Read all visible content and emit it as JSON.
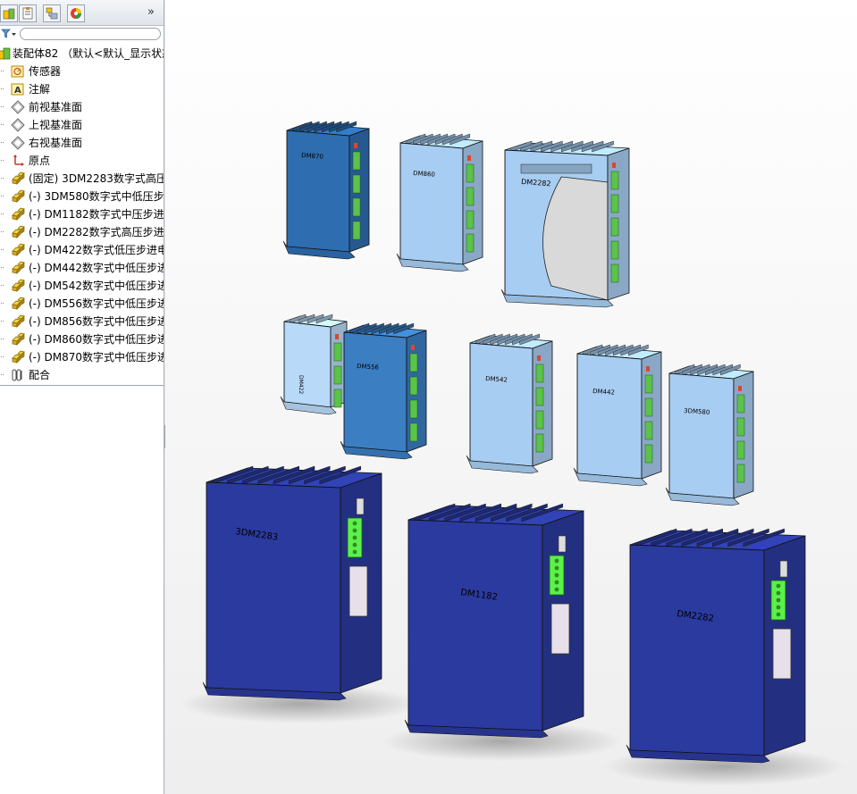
{
  "feature_manager": {
    "tabs": [
      {
        "name": "featuremanager-tree-tab",
        "icon": "assembly-tree-icon"
      },
      {
        "name": "propertymanager-tab",
        "icon": "property-sheet-icon"
      },
      {
        "name": "configurationmanager-tab",
        "icon": "configuration-icon"
      },
      {
        "name": "displaymanager-tab",
        "icon": "appearance-pie-icon"
      }
    ],
    "more_glyph": "»",
    "tree": {
      "root": "装配体82 （默认<默认_显示状态",
      "items": [
        {
          "label": "传感器",
          "icon": "sensor-icon"
        },
        {
          "label": "注解",
          "icon": "annotation-icon"
        },
        {
          "label": "前视基准面",
          "icon": "plane-icon"
        },
        {
          "label": "上视基准面",
          "icon": "plane-icon"
        },
        {
          "label": "右视基准面",
          "icon": "plane-icon"
        },
        {
          "label": "原点",
          "icon": "origin-icon"
        },
        {
          "label": "(固定) 3DM2283数字式高压",
          "icon": "part-icon"
        },
        {
          "label": "(-) 3DM580数字式中低压步",
          "icon": "part-icon"
        },
        {
          "label": "(-) DM1182数字式中压步进",
          "icon": "part-icon"
        },
        {
          "label": "(-) DM2282数字式高压步进",
          "icon": "part-icon"
        },
        {
          "label": "(-) DM422数字式低压步进电",
          "icon": "part-icon"
        },
        {
          "label": "(-) DM442数字式中低压步进",
          "icon": "part-icon"
        },
        {
          "label": "(-) DM542数字式中低压步进",
          "icon": "part-icon"
        },
        {
          "label": "(-) DM556数字式中低压步进",
          "icon": "part-icon"
        },
        {
          "label": "(-) DM856数字式中低压步进",
          "icon": "part-icon"
        },
        {
          "label": "(-) DM860数字式中低压步进",
          "icon": "part-icon"
        },
        {
          "label": "(-) DM870数字式中低压步进",
          "icon": "part-icon"
        },
        {
          "label": "配合",
          "icon": "mates-icon"
        }
      ]
    }
  },
  "viewport": {
    "drivers": [
      {
        "id": "driver-dm870",
        "label": "DM870",
        "color": "#2e6db0"
      },
      {
        "id": "driver-dm860",
        "label": "DM860",
        "color": "#a8cdf2"
      },
      {
        "id": "driver-dm2282-small",
        "label": "DM2282",
        "color": "#a8cdf2"
      },
      {
        "id": "driver-dm422",
        "label": "DM422",
        "color": "#b8d9f7"
      },
      {
        "id": "driver-dm556",
        "label": "DM556",
        "color": "#3b7ec2"
      },
      {
        "id": "driver-dm542",
        "label": "DM542",
        "color": "#a8cdf2"
      },
      {
        "id": "driver-dm442",
        "label": "DM442",
        "color": "#a8cdf2"
      },
      {
        "id": "driver-3dm580",
        "label": "3DM580",
        "color": "#a8cdf2"
      },
      {
        "id": "driver-3dm2283",
        "label": "3DM2283",
        "color": "#2b3a9e"
      },
      {
        "id": "driver-dm1182",
        "label": "DM1182",
        "color": "#2b3a9e"
      },
      {
        "id": "driver-dm2282",
        "label": "DM2282",
        "color": "#2b3a9e"
      }
    ]
  }
}
